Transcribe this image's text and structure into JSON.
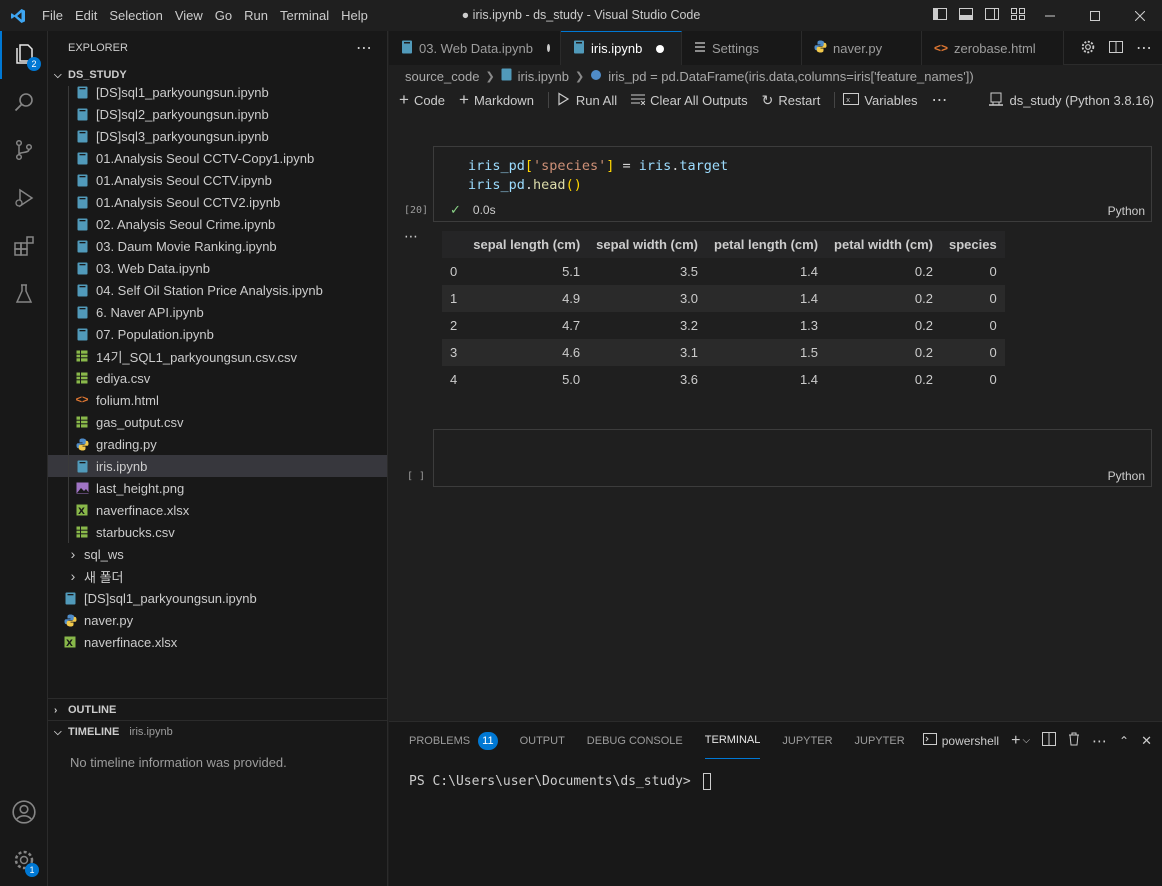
{
  "window": {
    "title": "● iris.ipynb - ds_study - Visual Studio Code",
    "menu": [
      "File",
      "Edit",
      "Selection",
      "View",
      "Go",
      "Run",
      "Terminal",
      "Help"
    ]
  },
  "activity_bar": {
    "explorer_badge": "2",
    "settings_badge": "1"
  },
  "sidebar": {
    "explorer_title": "EXPLORER",
    "folder_name": "DS_STUDY",
    "items": [
      {
        "label": "[DS]sql1_parkyoungsun.ipynb",
        "type": "ipynb"
      },
      {
        "label": "[DS]sql2_parkyoungsun.ipynb",
        "type": "ipynb"
      },
      {
        "label": "[DS]sql3_parkyoungsun.ipynb",
        "type": "ipynb"
      },
      {
        "label": "01.Analysis Seoul CCTV-Copy1.ipynb",
        "type": "ipynb"
      },
      {
        "label": "01.Analysis Seoul CCTV.ipynb",
        "type": "ipynb"
      },
      {
        "label": "01.Analysis Seoul CCTV2.ipynb",
        "type": "ipynb"
      },
      {
        "label": "02. Analysis Seoul Crime.ipynb",
        "type": "ipynb"
      },
      {
        "label": "03. Daum Movie Ranking.ipynb",
        "type": "ipynb"
      },
      {
        "label": "03. Web Data.ipynb",
        "type": "ipynb"
      },
      {
        "label": "04. Self Oil Station Price Analysis.ipynb",
        "type": "ipynb"
      },
      {
        "label": "6. Naver API.ipynb",
        "type": "ipynb"
      },
      {
        "label": "07. Population.ipynb",
        "type": "ipynb"
      },
      {
        "label": "14기_SQL1_parkyoungsun.csv.csv",
        "type": "csv"
      },
      {
        "label": "ediya.csv",
        "type": "csv"
      },
      {
        "label": "folium.html",
        "type": "html"
      },
      {
        "label": "gas_output.csv",
        "type": "csv"
      },
      {
        "label": "grading.py",
        "type": "py"
      },
      {
        "label": "iris.ipynb",
        "type": "ipynb",
        "selected": true
      },
      {
        "label": "last_height.png",
        "type": "png"
      },
      {
        "label": "naverfinace.xlsx",
        "type": "xlsx"
      },
      {
        "label": "starbucks.csv",
        "type": "csv"
      }
    ],
    "folders": [
      {
        "label": "sql_ws"
      },
      {
        "label": "새 폴더"
      }
    ],
    "root_items": [
      {
        "label": "[DS]sql1_parkyoungsun.ipynb",
        "type": "ipynb"
      },
      {
        "label": "naver.py",
        "type": "py"
      },
      {
        "label": "naverfinace.xlsx",
        "type": "xlsx"
      }
    ],
    "outline_title": "OUTLINE",
    "timeline_title": "TIMELINE",
    "timeline_file": "iris.ipynb",
    "timeline_message": "No timeline information was provided."
  },
  "tabs": [
    {
      "label": "03. Web Data.ipynb",
      "icon": "notebook-icon",
      "modified": true,
      "active": false
    },
    {
      "label": "iris.ipynb",
      "icon": "notebook-icon",
      "modified": true,
      "active": true
    },
    {
      "label": "Settings",
      "icon": "settings-list-icon",
      "modified": false,
      "active": false
    },
    {
      "label": "naver.py",
      "icon": "python-icon",
      "modified": false,
      "active": false
    },
    {
      "label": "zerobase.html",
      "icon": "html-icon",
      "modified": false,
      "active": false
    }
  ],
  "breadcrumb": {
    "folder": "source_code",
    "file": "iris.ipynb",
    "symbol": "iris_pd = pd.DataFrame(iris.data,columns=iris['feature_names'])"
  },
  "notebook_toolbar": {
    "code": "Code",
    "markdown": "Markdown",
    "run_all": "Run All",
    "clear_outputs": "Clear All Outputs",
    "restart": "Restart",
    "variables": "Variables",
    "kernel": "ds_study (Python 3.8.16)"
  },
  "cell1": {
    "exec_count": "[20]",
    "line1": {
      "a": "iris_pd",
      "b": "[",
      "c": "'species'",
      "d": "]",
      "e": " = ",
      "f": "iris",
      "g": ".",
      "h": "target"
    },
    "line2": {
      "a": "iris_pd",
      "b": ".",
      "c": "head",
      "d": "()"
    },
    "status_time": "0.0s",
    "language": "Python"
  },
  "output_table": {
    "columns": [
      "",
      "sepal length (cm)",
      "sepal width (cm)",
      "petal length (cm)",
      "petal width (cm)",
      "species"
    ],
    "rows": [
      [
        "0",
        "5.1",
        "3.5",
        "1.4",
        "0.2",
        "0"
      ],
      [
        "1",
        "4.9",
        "3.0",
        "1.4",
        "0.2",
        "0"
      ],
      [
        "2",
        "4.7",
        "3.2",
        "1.3",
        "0.2",
        "0"
      ],
      [
        "3",
        "4.6",
        "3.1",
        "1.5",
        "0.2",
        "0"
      ],
      [
        "4",
        "5.0",
        "3.6",
        "1.4",
        "0.2",
        "0"
      ]
    ]
  },
  "cell2": {
    "exec_count": "[ ]",
    "language": "Python"
  },
  "panel": {
    "tabs": [
      "PROBLEMS",
      "OUTPUT",
      "DEBUG CONSOLE",
      "TERMINAL",
      "JUPYTER",
      "JUPYTER"
    ],
    "problems_count": "11",
    "active_tab": "TERMINAL",
    "shell": "powershell",
    "prompt": "PS C:\\Users\\user\\Documents\\ds_study> "
  }
}
